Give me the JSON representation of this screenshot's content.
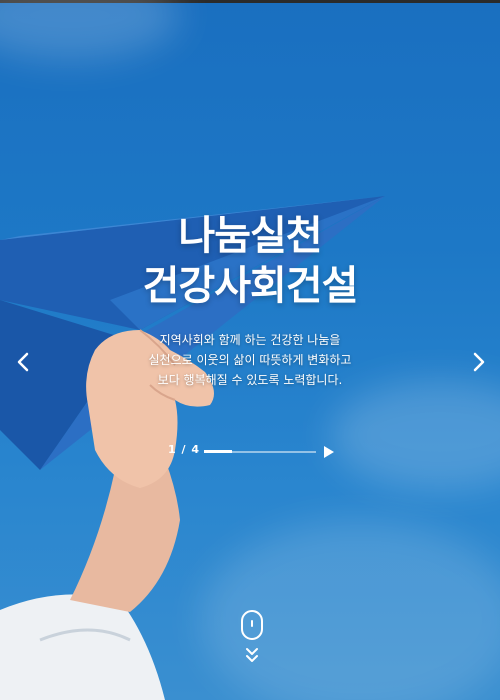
{
  "hero": {
    "title_line1": "나눔실천",
    "title_line2": "건강사회건설",
    "description_lines": [
      "지역사회와 함께 하는 건강한 나눔을",
      "실천으로 이웃의 삶이 따뜻하게 변화하고",
      "보다 행복해질 수 있도록 노력합니다."
    ],
    "background_color": "#1d78c6",
    "image_icon": "paper-airplane-hand-image"
  },
  "slider": {
    "counter": "1 / 4",
    "current": 1,
    "total": 4,
    "progress_fraction": 0.25,
    "prev_icon": "chevron-left-icon",
    "next_icon": "chevron-right-icon",
    "play_icon": "play-icon"
  },
  "scroll_indicator": {
    "mouse_icon": "mouse-icon",
    "down_icon": "double-chevron-down-icon"
  }
}
